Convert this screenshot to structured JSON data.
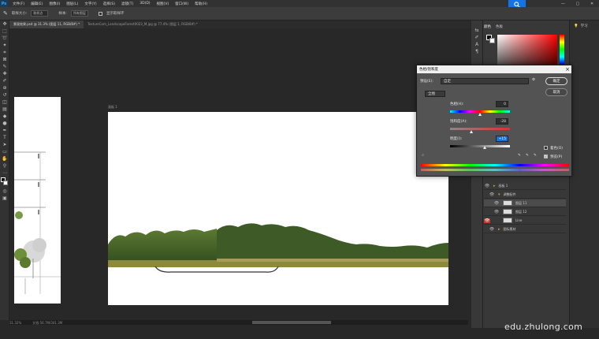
{
  "app": {
    "logo": "Ps",
    "menu": [
      "文件(F)",
      "编辑(E)",
      "图像(I)",
      "图层(L)",
      "文字(Y)",
      "选择(S)",
      "滤镜(T)",
      "3D(D)",
      "视图(V)",
      "窗口(W)",
      "帮助(H)"
    ],
    "window_controls": [
      "—",
      "▢",
      "✕"
    ]
  },
  "options": {
    "sample_size_label": "取样大小:",
    "sample_size_value": "取样点",
    "sample_label": "样本:",
    "sample_value": "所有图层",
    "ring_label": "显示取样环"
  },
  "tabs": [
    {
      "label": "景观效果.psd @ 31.3% (图层 11, RGB/8#) *"
    },
    {
      "label": "TextureCom_LandscapeForest0023_M.jpg @ 77.4% (图层 1, RGB/8#) *"
    }
  ],
  "doc": {
    "artboard_label": "画板 1",
    "status_zoom": "31.32%",
    "status_doc": "文档:56.7M/341.3M"
  },
  "color_panel": {
    "tab_color": "颜色",
    "tab_swatches": "色板",
    "fg": "#000000",
    "bg": "#ffffff"
  },
  "learn_label": "学习",
  "layers": [
    {
      "name": "画板 1",
      "type": "folder",
      "visible": true
    },
    {
      "name": "调整配件",
      "type": "folder",
      "visible": true
    },
    {
      "name": "图层 11",
      "type": "layer",
      "visible": true,
      "selected": true
    },
    {
      "name": "图层 12",
      "type": "layer",
      "visible": true
    },
    {
      "name": "Line",
      "type": "layer",
      "visible": true,
      "red_eye": true
    },
    {
      "name": "图标素材",
      "type": "folder",
      "visible": true
    }
  ],
  "dialog": {
    "title": "色相/饱和度",
    "preset_label": "预设(E):",
    "preset_value": "自定",
    "channel_value": "全图",
    "hue_label": "色相(H):",
    "hue_value": "0",
    "sat_label": "饱和度(A):",
    "sat_value": "-28",
    "light_label": "明度(I):",
    "light_value": "+15",
    "ok": "确定",
    "cancel": "取消",
    "colorize": "着色(O)",
    "preview": "预览(P)",
    "colorize_checked": false,
    "preview_checked": true
  },
  "watermark": "edu.zhulong.com"
}
